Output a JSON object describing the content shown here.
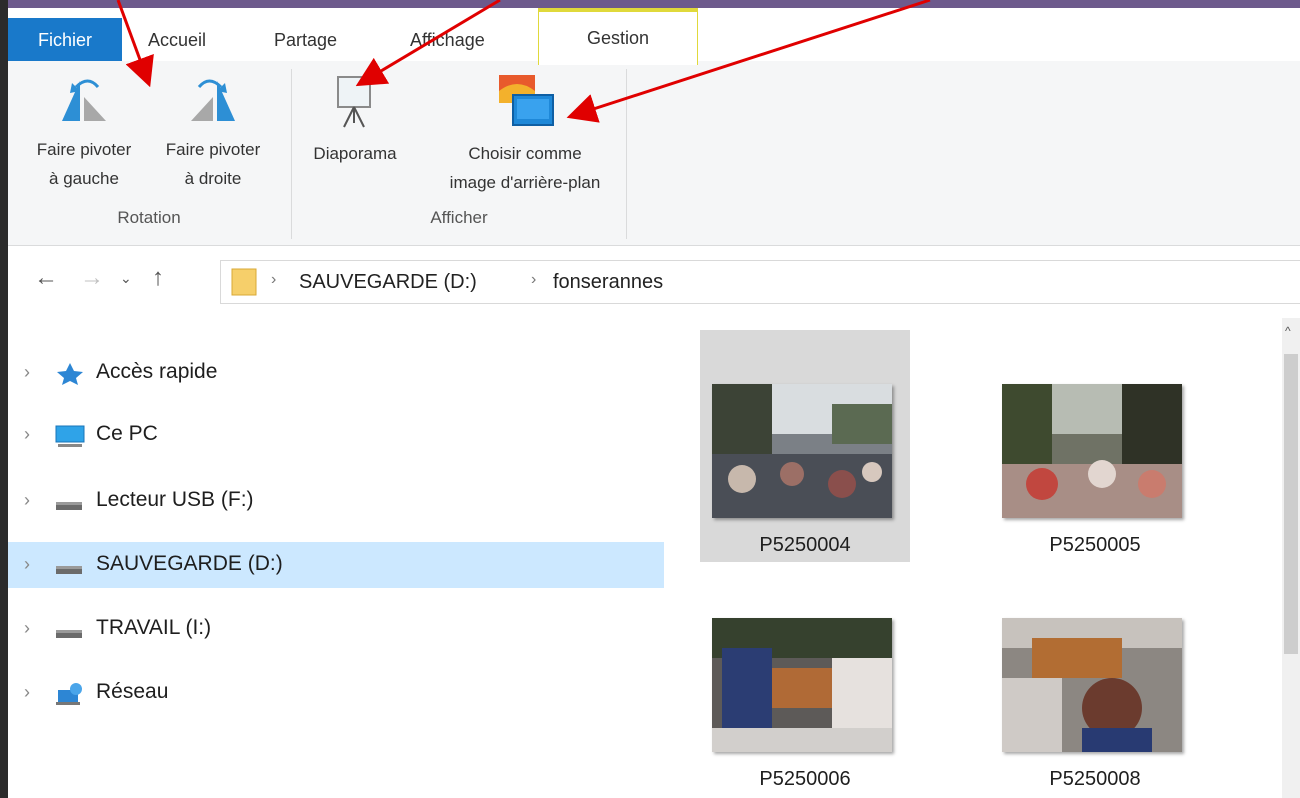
{
  "tabs": {
    "file": "Fichier",
    "home": "Accueil",
    "share": "Partage",
    "view": "Affichage",
    "manage": "Gestion"
  },
  "ribbon": {
    "rotation": {
      "rotate_left_line1": "Faire pivoter",
      "rotate_left_line2": "à gauche",
      "rotate_right_line1": "Faire pivoter",
      "rotate_right_line2": "à droite",
      "label": "Rotation"
    },
    "afficher": {
      "slideshow": "Diaporama",
      "wallpaper_line1": "Choisir comme",
      "wallpaper_line2": "image d'arrière-plan",
      "label": "Afficher"
    }
  },
  "address": {
    "crumbs": [
      "SAUVEGARDE (D:)",
      "fonserannes"
    ]
  },
  "navpane": {
    "items": [
      {
        "label": "Accès rapide",
        "icon": "star-icon"
      },
      {
        "label": "Ce PC",
        "icon": "computer-icon"
      },
      {
        "label": "Lecteur USB (F:)",
        "icon": "drive-icon"
      },
      {
        "label": "SAUVEGARDE (D:)",
        "icon": "drive-icon",
        "selected": true
      },
      {
        "label": "TRAVAIL (I:)",
        "icon": "drive-icon"
      },
      {
        "label": "Réseau",
        "icon": "network-icon"
      }
    ]
  },
  "files": [
    {
      "name": "P5250004",
      "selected": true
    },
    {
      "name": "P5250005"
    },
    {
      "name": "P5250006"
    },
    {
      "name": "P5250008"
    }
  ],
  "colors": {
    "file_tab": "#1979ca",
    "selection": "#cce8ff",
    "contextual_tab": "#e0d93b",
    "annotation_arrow": "#e00000"
  }
}
